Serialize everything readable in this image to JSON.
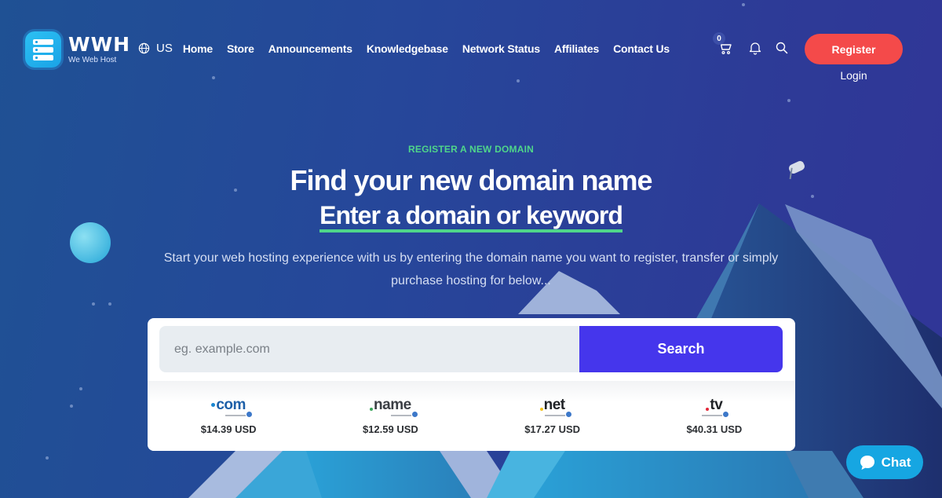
{
  "brand": {
    "name": "WWH",
    "tagline": "We Web Host",
    "logo_icon": "server-stack-icon",
    "color": "#1aa3e6"
  },
  "header": {
    "language": {
      "icon": "globe-icon",
      "label": "US"
    },
    "nav": [
      {
        "label": "Home"
      },
      {
        "label": "Store"
      },
      {
        "label": "Announcements"
      },
      {
        "label": "Knowledgebase"
      },
      {
        "label": "Network Status"
      },
      {
        "label": "Affiliates"
      },
      {
        "label": "Contact Us"
      }
    ],
    "cart": {
      "icon": "cart-icon",
      "count": "0"
    },
    "notifications_icon": "bell-icon",
    "search_icon": "search-icon",
    "register_label": "Register",
    "login_label": "Login",
    "register_color": "#f44a4a"
  },
  "hero": {
    "eyebrow": "REGISTER A NEW DOMAIN",
    "headline": "Find your new domain name",
    "subhead": "Enter a domain or keyword",
    "description": "Start your web hosting experience with us by entering the domain name you want to register, transfer or simply purchase hosting for below...",
    "accent_color": "#4fd68a"
  },
  "search": {
    "placeholder": "eg. example.com",
    "value": "",
    "button_label": "Search",
    "button_color": "#4536ec"
  },
  "tlds": [
    {
      "name": ".com",
      "dot_color": "#1a86d0",
      "text_color": "#1d5fa8",
      "price": "$14.39 USD"
    },
    {
      "name": ".name",
      "dot_color": "#3aa55a",
      "text_color": "#3a3e44",
      "price": "$12.59 USD"
    },
    {
      "name": ".net",
      "dot_color": "#f2c21a",
      "text_color": "#1f2226",
      "price": "$17.27 USD"
    },
    {
      "name": ".tv",
      "dot_color": "#e2283a",
      "text_color": "#1f2226",
      "price": "$40.31 USD"
    }
  ],
  "chat": {
    "icon": "chat-bubble-icon",
    "label": "Chat",
    "color": "#16a6e2"
  }
}
